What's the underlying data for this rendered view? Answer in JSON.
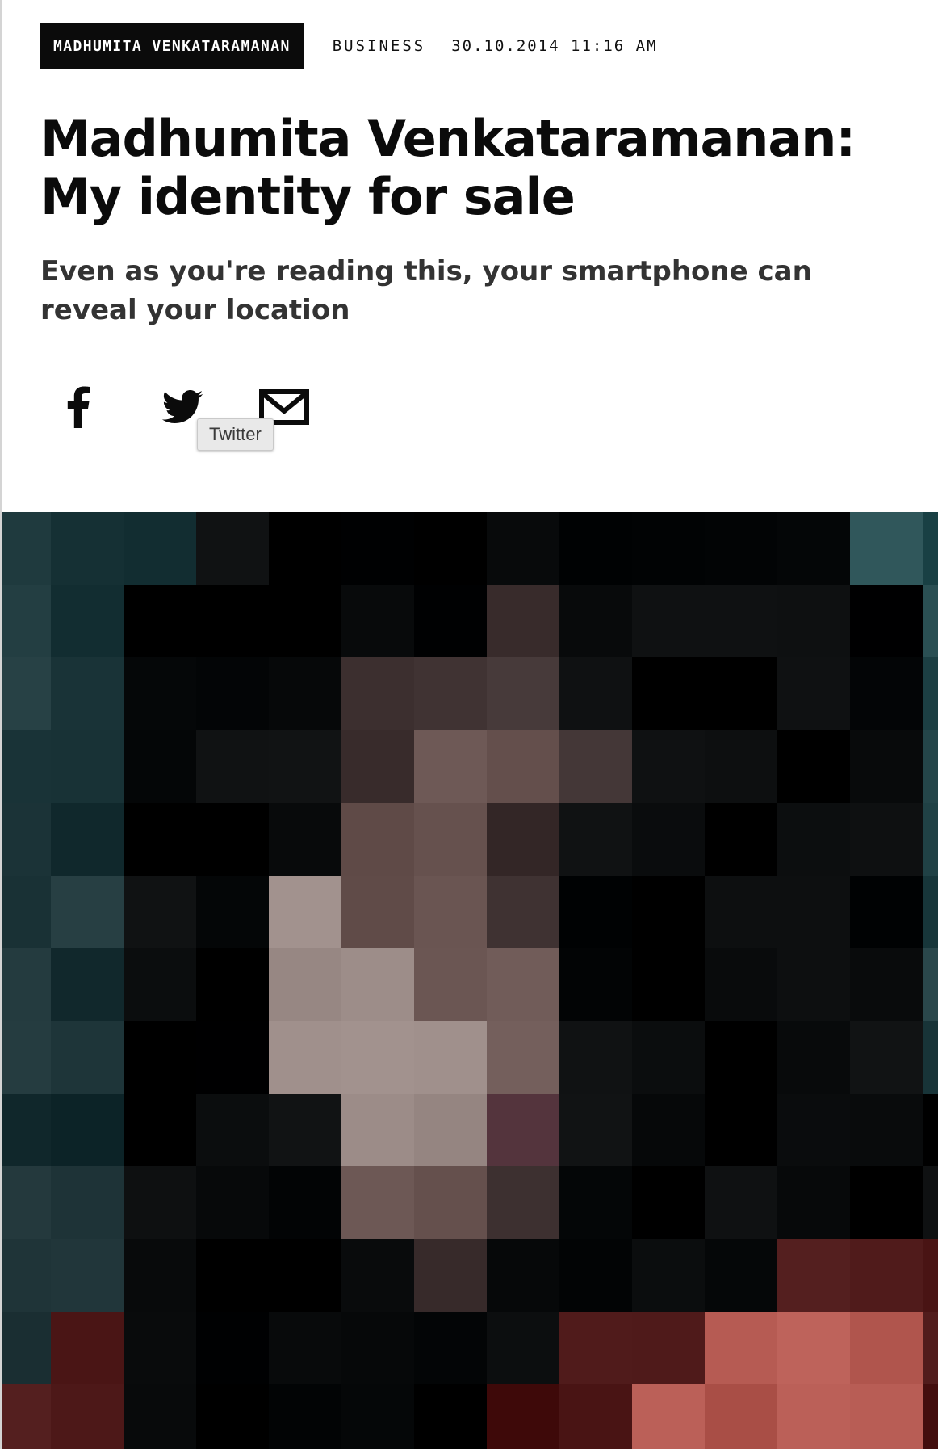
{
  "article": {
    "author": "MADHUMITA VENKATARAMANAN",
    "section": "BUSINESS",
    "datetime": "30.10.2014 11:16 AM",
    "headline": "Madhumita Venkataramanan: My identity for sale",
    "standfirst": "Even as you're reading this, your smartphone can reveal your location"
  },
  "share": {
    "items": [
      {
        "network": "Facebook",
        "icon": "facebook-icon"
      },
      {
        "network": "Twitter",
        "icon": "twitter-icon"
      },
      {
        "network": "Email",
        "icon": "mail-icon"
      }
    ],
    "tooltip": "Twitter"
  },
  "hero": {
    "subject": "pixelated portrait",
    "palette": {
      "background": "#0c1618",
      "teal_light": "#2f6266",
      "teal_dark": "#132226",
      "hair": "#050708",
      "skin_light": "#9a8a86",
      "skin_mid": "#6a5552",
      "skin_shadow": "#3a2d2d",
      "lips": "#4a2a33",
      "red_light": "#b35850",
      "red_dark": "#4a1515"
    }
  }
}
